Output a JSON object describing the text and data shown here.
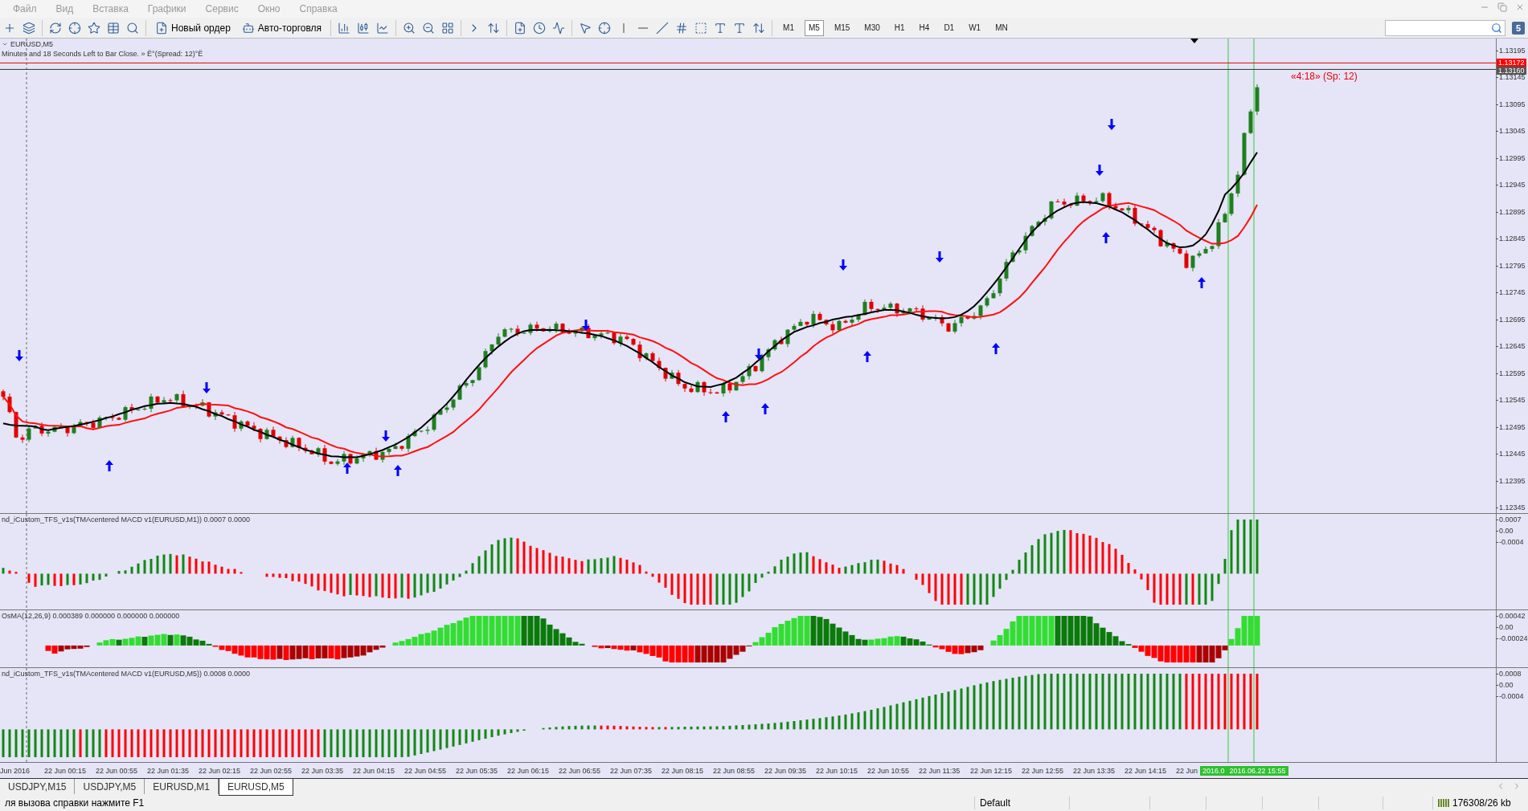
{
  "menu": [
    "Файл",
    "Вид",
    "Вставка",
    "Графики",
    "Сервис",
    "Окно",
    "Справка"
  ],
  "toolbar": {
    "buttons": [
      {
        "label": "Новый ордер"
      },
      {
        "label": "Авто-торговля"
      }
    ],
    "timeframes": [
      {
        "label": "M1",
        "selected": false
      },
      {
        "label": "M5",
        "selected": true
      },
      {
        "label": "M15",
        "selected": false
      },
      {
        "label": "M30",
        "selected": false
      },
      {
        "label": "H1",
        "selected": false
      },
      {
        "label": "H4",
        "selected": false
      },
      {
        "label": "D1",
        "selected": false
      },
      {
        "label": "W1",
        "selected": false
      },
      {
        "label": "MN",
        "selected": false
      }
    ],
    "notifications": "5"
  },
  "chart": {
    "title": "EURUSD,M5",
    "info": "Minutes and 18 Seconds Left to Bar Close. » Ë°(Spread: 12)°Ë",
    "timer_label": "«4:18» (Sp: 12)",
    "price_axis": [
      "1.13195",
      "1.13145",
      "1.13095",
      "1.13045",
      "1.12995",
      "1.12945",
      "1.12895",
      "1.12845",
      "1.12795",
      "1.12745",
      "1.12695",
      "1.12645",
      "1.12595",
      "1.12545",
      "1.12495",
      "1.12445",
      "1.12395",
      "1.12345"
    ],
    "bid_price": "1.13172",
    "ask_price": "1.13160"
  },
  "indicators": [
    {
      "kind": "macd",
      "label": "nd_iCustom_TFS_v1s(TMAcentered MACD v1(EURUSD,M1)) 0.0007 0.0000",
      "axis": [
        "0.0007",
        "0.00",
        "-0.0004"
      ]
    },
    {
      "kind": "osma",
      "label": "OsMA(12,26,9) 0.000389 0.000000 0.000000 0.000000",
      "axis": [
        "0.00042",
        "0.00",
        "-0.00024"
      ]
    },
    {
      "kind": "macd",
      "label": "nd_iCustom_TFS_v1s(TMAcentered MACD v1(EURUSD,M5)) 0.0008 0.0000",
      "axis": [
        "0.0008",
        "0.00",
        "-0.0004"
      ]
    }
  ],
  "time_axis": {
    "labels": [
      "Jun 2016",
      "22 Jun 00:15",
      "22 Jun 00:55",
      "22 Jun 01:35",
      "22 Jun 02:15",
      "22 Jun 02:55",
      "22 Jun 03:35",
      "22 Jun 04:15",
      "22 Jun 04:55",
      "22 Jun 05:35",
      "22 Jun 06:15",
      "22 Jun 06:55",
      "22 Jun 07:35",
      "22 Jun 08:15",
      "22 Jun 08:55",
      "22 Jun 09:35",
      "22 Jun 10:15",
      "22 Jun 10:55",
      "22 Jun 11:35",
      "22 Jun 12:15",
      "22 Jun 12:55",
      "22 Jun 13:35",
      "22 Jun 14:15",
      "22 Jun"
    ],
    "cursor_labels": [
      "2016.0",
      "2016.06.22 15:55"
    ]
  },
  "tabs": [
    {
      "label": "USDJPY,M15",
      "selected": false
    },
    {
      "label": "USDJPY,M5",
      "selected": false
    },
    {
      "label": "EURUSD,M1",
      "selected": false
    },
    {
      "label": "EURUSD,M5",
      "selected": true
    }
  ],
  "status_bar": {
    "hint": "ля вызова справки нажмите F1",
    "profile": "Default",
    "traffic": "176308/26 kb"
  }
}
